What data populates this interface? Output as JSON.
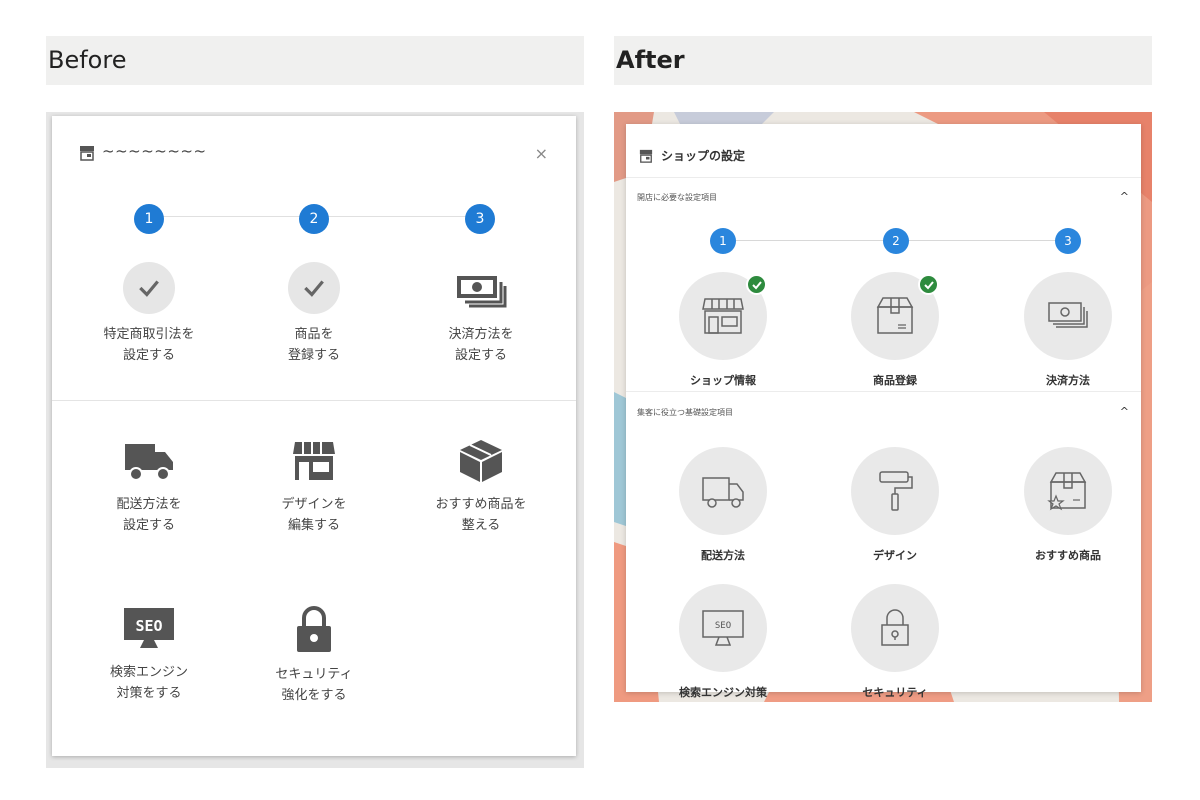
{
  "before": {
    "heading": "Before",
    "title": "~~~~~~~~",
    "close": "×",
    "steps": [
      "1",
      "2",
      "3"
    ],
    "setup_items": [
      {
        "line1": "特定商取引法を",
        "line2": "設定する",
        "icon": "check-icon"
      },
      {
        "line1": "商品を",
        "line2": "登録する",
        "icon": "check-icon"
      },
      {
        "line1": "決済方法を",
        "line2": "設定する",
        "icon": "money-icon"
      }
    ],
    "feature_items": [
      {
        "line1": "配送方法を",
        "line2": "設定する",
        "icon": "truck-icon"
      },
      {
        "line1": "デザインを",
        "line2": "編集する",
        "icon": "storefront-icon"
      },
      {
        "line1": "おすすめ商品を",
        "line2": "整える",
        "icon": "box-icon"
      },
      {
        "line1": "検索エンジン",
        "line2": "対策をする",
        "icon": "seo-monitor-icon",
        "icon_text": "SEO"
      },
      {
        "line1": "セキュリティ",
        "line2": "強化をする",
        "icon": "lock-icon"
      }
    ]
  },
  "after": {
    "heading": "After",
    "title": "ショップの設定",
    "section1_label": "開店に必要な設定項目",
    "section2_label": "集客に役立つ基礎設定項目",
    "chevron": "^",
    "steps": [
      "1",
      "2",
      "3"
    ],
    "setup_items": [
      {
        "label": "ショップ情報",
        "icon": "shop-icon",
        "done": true
      },
      {
        "label": "商品登録",
        "icon": "package-icon",
        "done": true
      },
      {
        "label": "決済方法",
        "icon": "bills-icon",
        "done": false
      }
    ],
    "feature_items": [
      {
        "label": "配送方法",
        "icon": "truck-icon"
      },
      {
        "label": "デザイン",
        "icon": "paint-roller-icon"
      },
      {
        "label": "おすすめ商品",
        "icon": "starred-box-icon"
      },
      {
        "label": "検索エンジン対策",
        "icon": "seo-monitor-icon",
        "icon_text": "SEO"
      },
      {
        "label": "セキュリティ",
        "icon": "padlock-icon"
      }
    ]
  },
  "colors": {
    "step_blue_before": "#1f7bd4",
    "step_blue_after": "#2a86dd",
    "done_green": "#2e8b3e",
    "icon_gray": "#555555",
    "circle_gray": "#e9e9e9"
  }
}
